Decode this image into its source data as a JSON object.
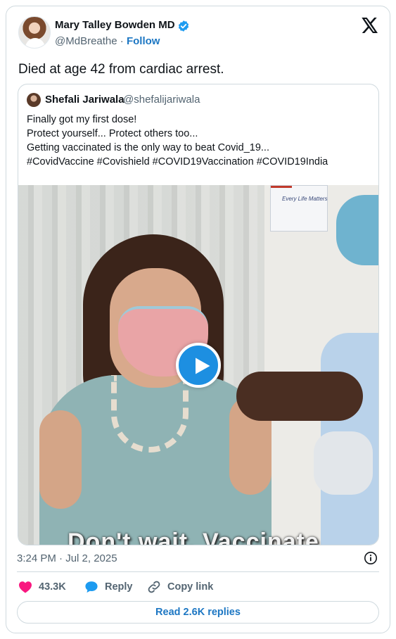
{
  "author": {
    "name": "Mary Talley Bowden MD",
    "handle": "@MdBreathe",
    "separator": " · ",
    "follow_label": "Follow"
  },
  "tweet": {
    "text": "Died at age 42 from cardiac arrest."
  },
  "quoted_tweet": {
    "name": "Shefali Jariwala",
    "handle": "@shefalijariwala",
    "lines": [
      "Finally got my first dose!",
      "Protect yourself... Protect others too...",
      "Getting vaccinated is the only way to beat Covid_19...",
      "#CovidVaccine #Covishield #COVID19Vaccination #COVID19India"
    ],
    "video": {
      "caption": "Don't wait. Vaccinate",
      "poster_text": "Every Life Matters"
    }
  },
  "meta": {
    "timestamp": "3:24 PM · Jul 2, 2025"
  },
  "actions": {
    "like_count": "43.3K",
    "reply_label": "Reply",
    "copy_label": "Copy link",
    "read_replies_label": "Read 2.6K replies"
  },
  "colors": {
    "link_blue": "#1d77c3",
    "verified_blue": "#1d9bf0",
    "like_pink": "#f91880",
    "text_secondary": "#536471",
    "border": "#cfd9de"
  },
  "icons": [
    "verified-badge-icon",
    "x-logo-icon",
    "play-icon",
    "info-icon",
    "heart-icon",
    "reply-bubble-icon",
    "link-icon"
  ]
}
